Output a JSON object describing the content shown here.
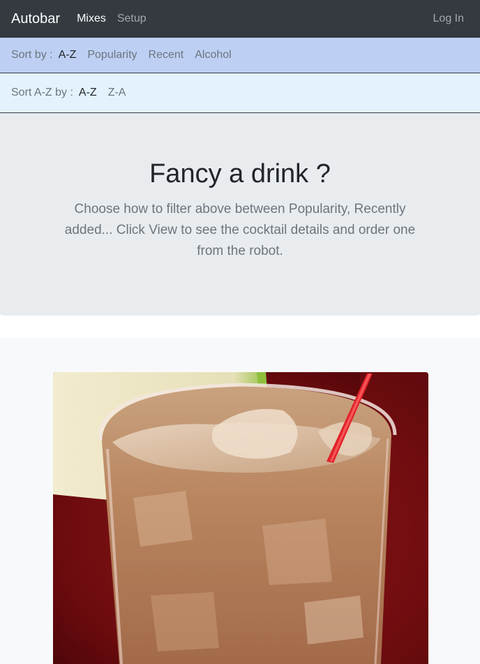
{
  "navbar": {
    "brand": "Autobar",
    "links": [
      {
        "label": "Mixes",
        "active": true
      },
      {
        "label": "Setup",
        "active": false
      }
    ],
    "login": "Log In"
  },
  "sort_primary": {
    "label": "Sort by :",
    "options": [
      {
        "label": "A-Z",
        "active": true
      },
      {
        "label": "Popularity",
        "active": false
      },
      {
        "label": "Recent",
        "active": false
      },
      {
        "label": "Alcohol",
        "active": false
      }
    ]
  },
  "sort_secondary": {
    "label": "Sort A-Z by :",
    "options": [
      {
        "label": "A-Z",
        "active": true
      },
      {
        "label": "Z-A",
        "active": false
      }
    ]
  },
  "jumbotron": {
    "title": "Fancy a drink ?",
    "text": "Choose how to filter above between Popularity, Recently added... Click View to see the cocktail details and order one from the robot."
  },
  "colors": {
    "navbar": "#343a40",
    "sort_primary_bg": "#bdd0f4",
    "sort_secondary_bg": "#e3f2fd",
    "jumbotron_bg": "#e9ecef",
    "album_bg": "#f8f9fa"
  }
}
